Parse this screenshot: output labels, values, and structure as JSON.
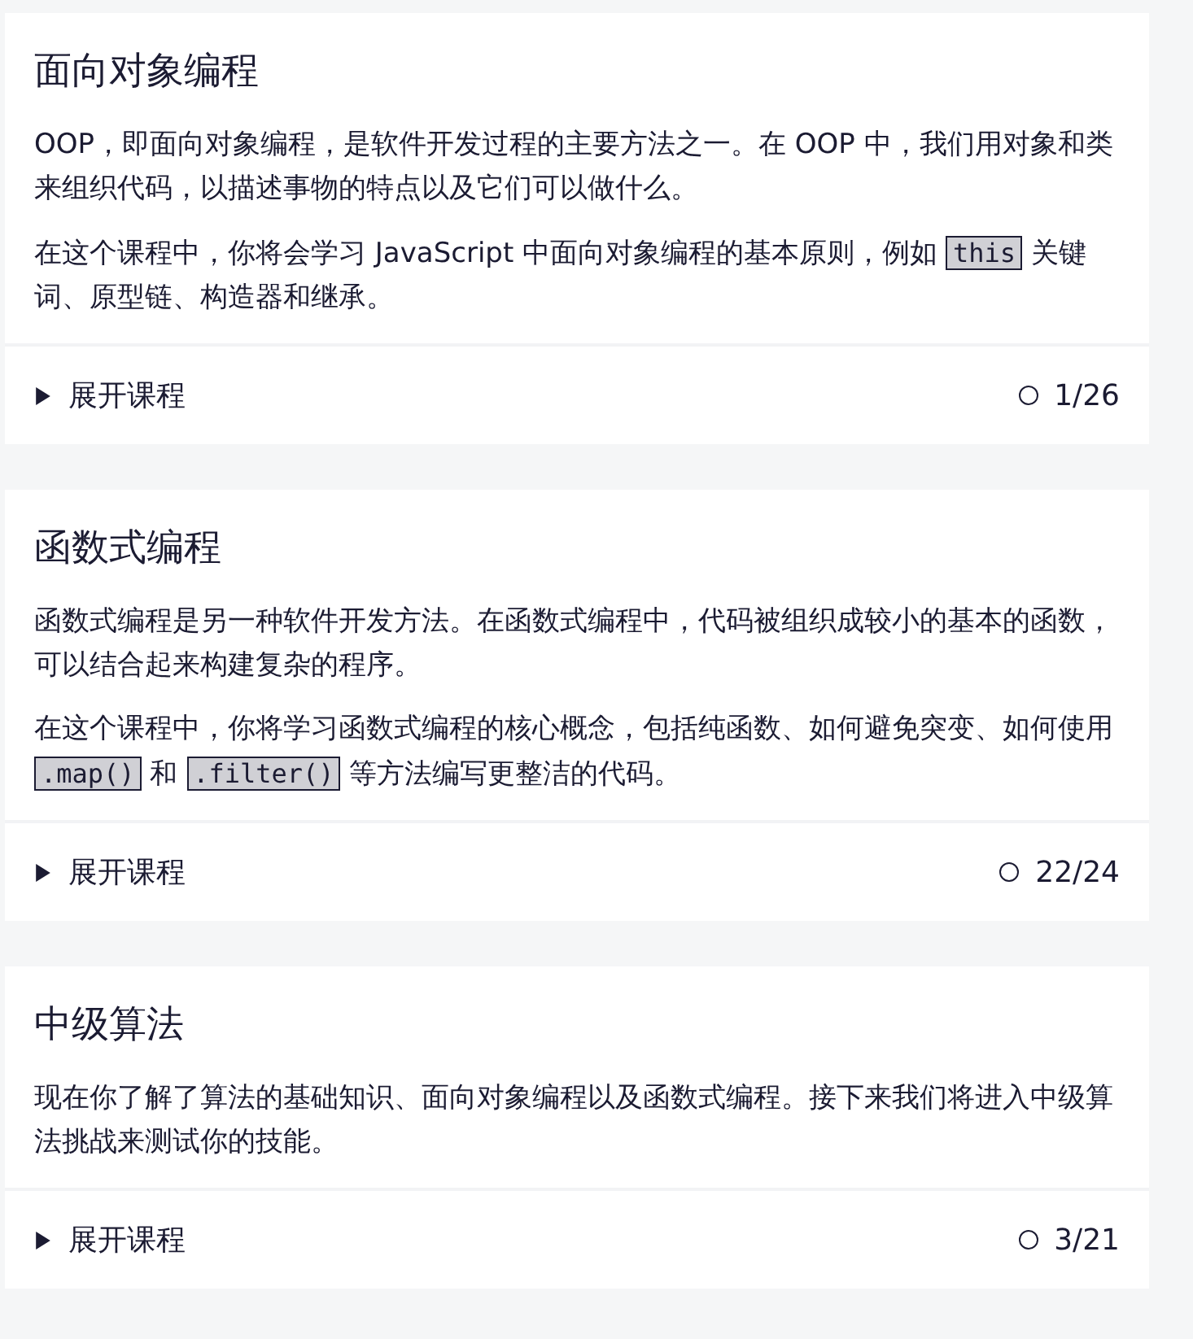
{
  "courses": [
    {
      "title": "面向对象编程",
      "paragraphs": [
        [
          {
            "kind": "text",
            "text": "OOP，即面向对象编程，是软件开发过程的主要方法之一。在 OOP 中，我们用对象和类来组织代码，以描述事物的特点以及它们可以做什么。"
          }
        ],
        [
          {
            "kind": "text",
            "text": "在这个课程中，你将会学习 JavaScript 中面向对象编程的基本原则，例如 "
          },
          {
            "kind": "code",
            "text": "this"
          },
          {
            "kind": "text",
            "text": " 关键词、原型链、构造器和继承。"
          }
        ]
      ],
      "toggle": "展开课程",
      "expanded": false,
      "progress": "1/26"
    },
    {
      "title": "函数式编程",
      "paragraphs": [
        [
          {
            "kind": "text",
            "text": "函数式编程是另一种软件开发方法。在函数式编程中，代码被组织成较小的基本的函数，可以结合起来构建复杂的程序。"
          }
        ],
        [
          {
            "kind": "text",
            "text": "在这个课程中，你将学习函数式编程的核心概念，包括纯函数、如何避免突变、如何使用 "
          },
          {
            "kind": "code",
            "text": ".map()"
          },
          {
            "kind": "text",
            "text": " 和 "
          },
          {
            "kind": "code",
            "text": ".filter()"
          },
          {
            "kind": "text",
            "text": " 等方法编写更整洁的代码。"
          }
        ]
      ],
      "toggle": "展开课程",
      "expanded": false,
      "progress": "22/24"
    },
    {
      "title": "中级算法",
      "paragraphs": [
        [
          {
            "kind": "text",
            "text": "现在你了解了算法的基础知识、面向对象编程以及函数式编程。接下来我们将进入中级算法挑战来测试你的技能。"
          }
        ]
      ],
      "toggle": "展开课程",
      "expanded": false,
      "progress": "3/21"
    }
  ]
}
